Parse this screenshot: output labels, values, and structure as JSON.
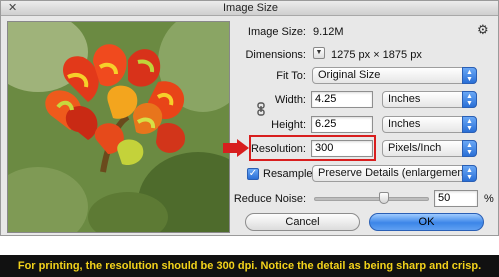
{
  "window": {
    "title": "Image Size"
  },
  "info": {
    "image_size_label": "Image Size:",
    "image_size_value": "9.12M",
    "dimensions_label": "Dimensions:",
    "dimensions_value": "1275 px  ×  1875 px"
  },
  "fit_to": {
    "label": "Fit To:",
    "value": "Original Size"
  },
  "width": {
    "label": "Width:",
    "value": "4.25",
    "unit": "Inches"
  },
  "height": {
    "label": "Height:",
    "value": "6.25",
    "unit": "Inches"
  },
  "resolution": {
    "label": "Resolution:",
    "value": "300",
    "unit": "Pixels/Inch"
  },
  "resample": {
    "label": "Resample:",
    "checked": true,
    "value": "Preserve Details (enlargement)"
  },
  "reduce_noise": {
    "label": "Reduce Noise:",
    "value": "50",
    "unit": "%",
    "level_percent": 50
  },
  "buttons": {
    "cancel": "Cancel",
    "ok": "OK"
  },
  "caption": "For printing, the resolution should be 300 dpi. Notice the detail as being sharp and crisp.",
  "colors": {
    "highlight": "#d81e1e",
    "caption_text": "#f2d21b",
    "caption_bg": "#111111",
    "accent": "#2a6fd6"
  },
  "icons": [
    "close-icon",
    "gear-icon",
    "dimensions-dropdown-icon",
    "link-icon",
    "pointer-arrow-icon"
  ]
}
